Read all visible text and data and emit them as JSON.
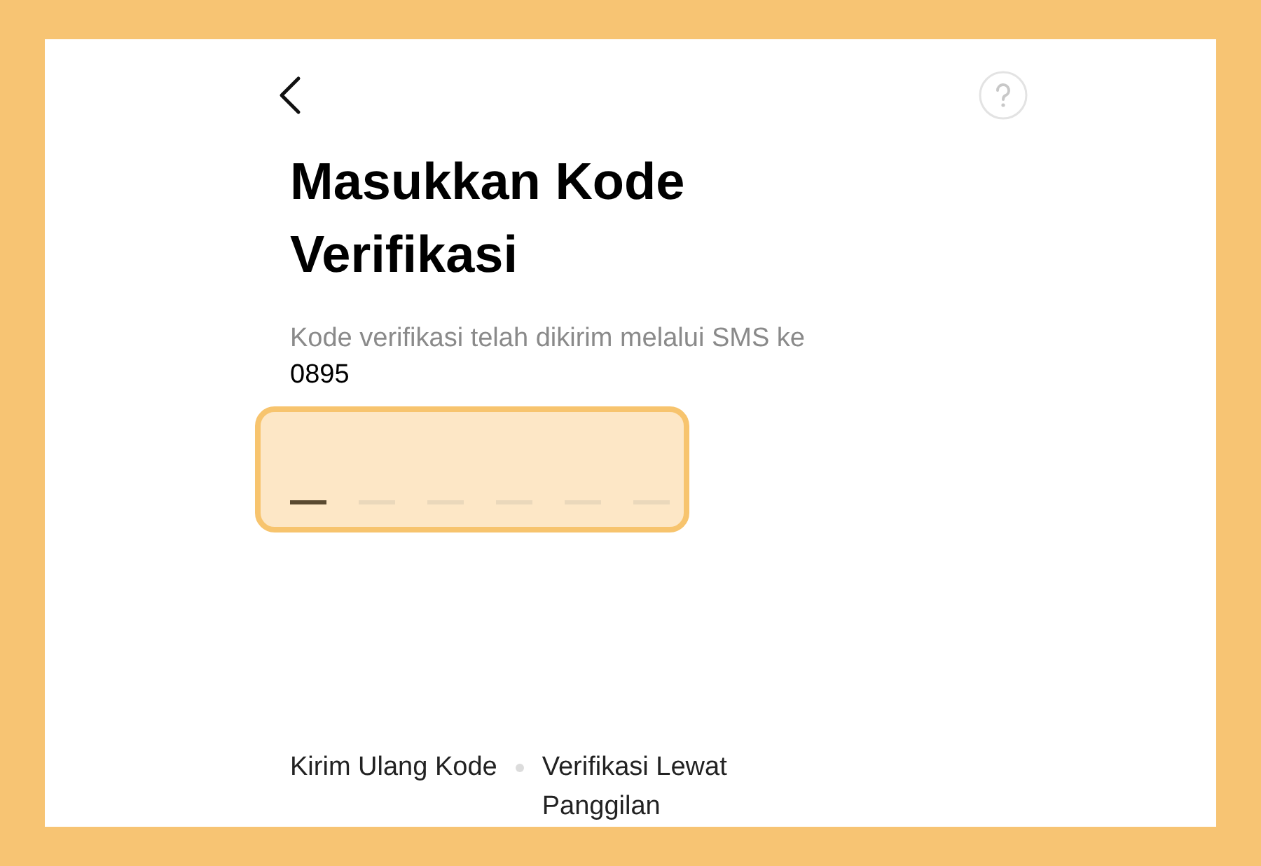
{
  "title": "Masukkan Kode Verifikasi",
  "subtitle": "Kode verifikasi telah dikirim melalui SMS ke",
  "phone": "0895",
  "code_slots": [
    {
      "active": true
    },
    {
      "active": false
    },
    {
      "active": false
    },
    {
      "active": false
    },
    {
      "active": false
    },
    {
      "active": false
    }
  ],
  "links": [
    "Kirim Ulang Kode",
    "Verifikasi Lewat Panggilan"
  ]
}
